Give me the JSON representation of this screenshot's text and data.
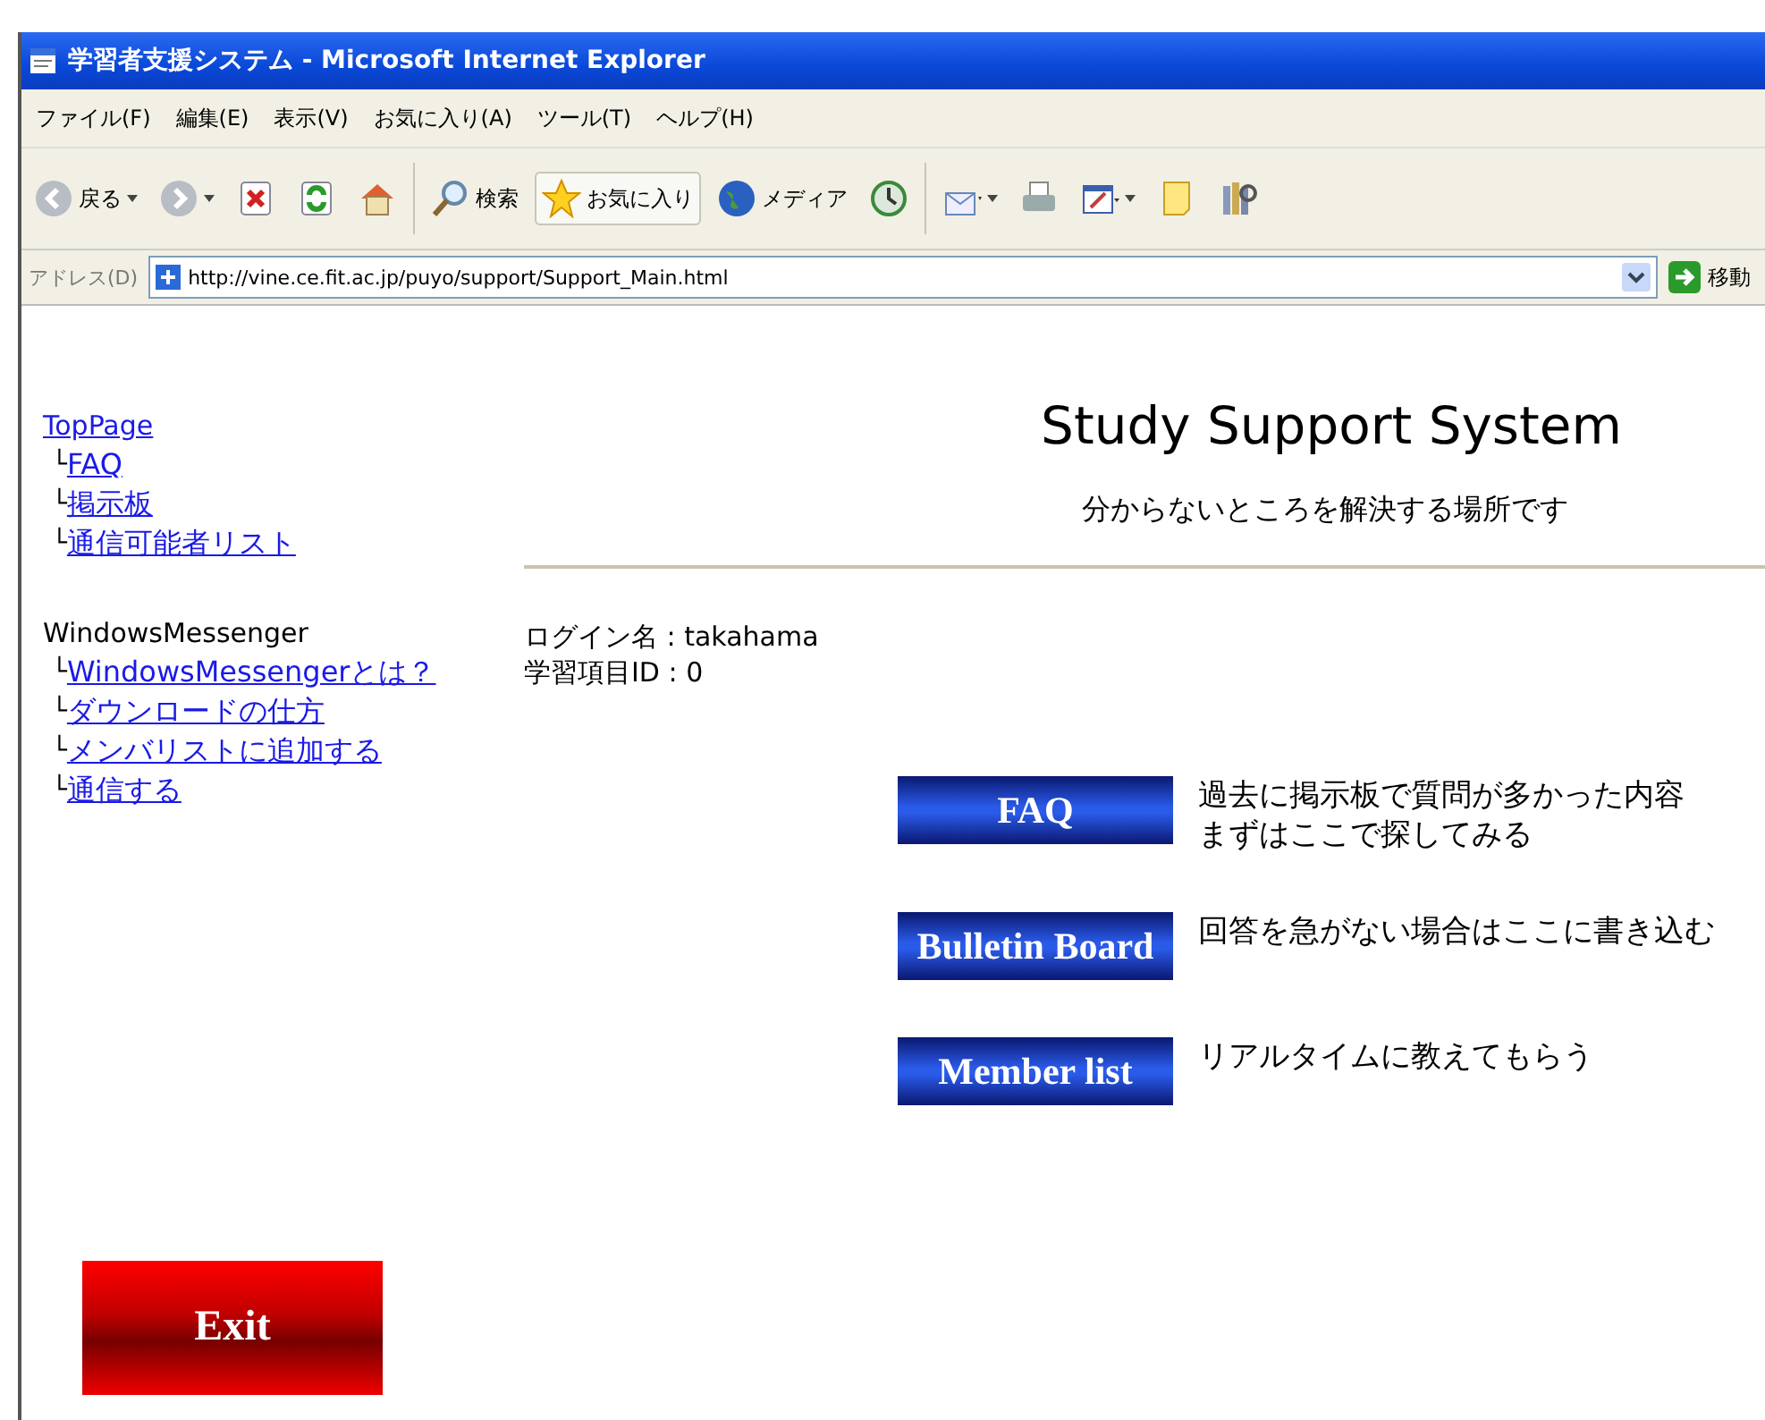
{
  "window": {
    "title": "学習者支援システム - Microsoft Internet Explorer"
  },
  "menu": [
    "ファイル(F)",
    "編集(E)",
    "表示(V)",
    "お気に入り(A)",
    "ツール(T)",
    "ヘルプ(H)"
  ],
  "toolbar": [
    {
      "kind": "back",
      "label": "戻る"
    },
    {
      "kind": "forward"
    },
    {
      "kind": "stop"
    },
    {
      "kind": "refresh"
    },
    {
      "kind": "home"
    },
    {
      "kind": "search",
      "label": "検索"
    },
    {
      "kind": "favorites",
      "label": "お気に入り"
    },
    {
      "kind": "media",
      "label": "メディア"
    },
    {
      "kind": "history"
    },
    {
      "kind": "mail"
    },
    {
      "kind": "print"
    },
    {
      "kind": "edit"
    },
    {
      "kind": "note"
    },
    {
      "kind": "research"
    }
  ],
  "address": {
    "label": "アドレス(D)",
    "value": "http://vine.ce.fit.ac.jp/puyo/support/Support_Main.html",
    "go": "移動"
  },
  "sidebar": {
    "groups": [
      {
        "title": "TopPage",
        "title_link": true,
        "children": [
          {
            "branch": "└",
            "label": "FAQ"
          },
          {
            "branch": "└",
            "label": "掲示板"
          },
          {
            "branch": "└",
            "label": "通信可能者リスト"
          }
        ]
      },
      {
        "title": "WindowsMessenger",
        "title_link": false,
        "children": [
          {
            "branch": "└",
            "label": "WindowsMessengerとは？"
          },
          {
            "branch": "└",
            "label": "ダウンロードの仕方"
          },
          {
            "branch": "└",
            "label": "メンバリストに追加する"
          },
          {
            "branch": "└",
            "label": "通信する"
          }
        ]
      }
    ],
    "exit": "Exit"
  },
  "header": {
    "title": "Study Support System",
    "subtitle": "分からないところを解決する場所です"
  },
  "info": [
    "ログイン名 : takahama",
    "学習項目ID : 0"
  ],
  "actions": [
    {
      "label": "FAQ",
      "description": [
        "過去に掲示板で質問が多かった内容",
        "まずはここで探してみる"
      ]
    },
    {
      "label": "Bulletin Board",
      "description": [
        "回答を急がない場合はここに書き込む"
      ]
    },
    {
      "label": "Member list",
      "description": [
        "リアルタイムに教えてもらう"
      ]
    }
  ]
}
